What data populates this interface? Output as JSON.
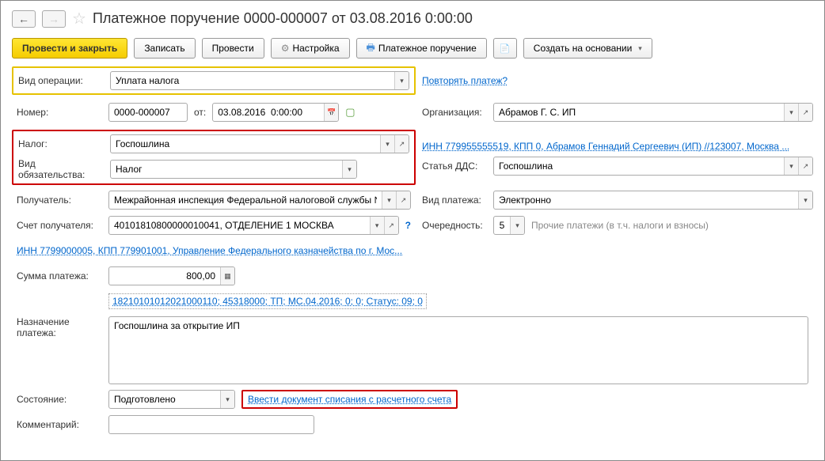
{
  "title": "Платежное поручение 0000-000007 от 03.08.2016 0:00:00",
  "toolbar": {
    "post_close": "Провести и закрыть",
    "save": "Записать",
    "post": "Провести",
    "settings": "Настройка",
    "print": "Платежное поручение",
    "create_based": "Создать на основании"
  },
  "labels": {
    "op_type": "Вид операции:",
    "repeat": "Повторять платеж?",
    "number": "Номер:",
    "from": "от:",
    "org": "Организация:",
    "tax": "Налог:",
    "obligation": "Вид обязательства:",
    "dds": "Статья ДДС:",
    "recipient": "Получатель:",
    "payment_type": "Вид платежа:",
    "recipient_acc": "Счет получателя:",
    "priority": "Очередность:",
    "priority_hint": "Прочие платежи (в т.ч. налоги и взносы)",
    "amount": "Сумма платежа:",
    "purpose": "Назначение платежа:",
    "state": "Состояние:",
    "comment": "Комментарий:"
  },
  "values": {
    "op_type": "Уплата налога",
    "number": "0000-000007",
    "date": "03.08.2016  0:00:00",
    "org": "Абрамов Г. С. ИП",
    "tax": "Госпошлина",
    "obligation": "Налог",
    "dds": "Госпошлина",
    "recipient": "Межрайонная инспекция Федеральной налоговой службы №",
    "payment_type": "Электронно",
    "recipient_acc": "40101810800000010041, ОТДЕЛЕНИЕ 1 МОСКВА",
    "priority": "5",
    "amount": "800,00",
    "purpose": "Госпошлина за открытие ИП",
    "state": "Подготовлено",
    "comment": ""
  },
  "links": {
    "org_details": "ИНН 779955555519, КПП 0, Абрамов Геннадий Сергеевич (ИП) //123007, Москва ...",
    "recipient_details": "ИНН 7799000005, КПП 779901001, Управление Федерального казначейства по г. Мос...",
    "kbk": "18210101012021000110; 45318000; ТП; МС.04.2016; 0; 0; Статус: 09; 0",
    "writeoff": "Ввести документ списания с расчетного счета"
  }
}
